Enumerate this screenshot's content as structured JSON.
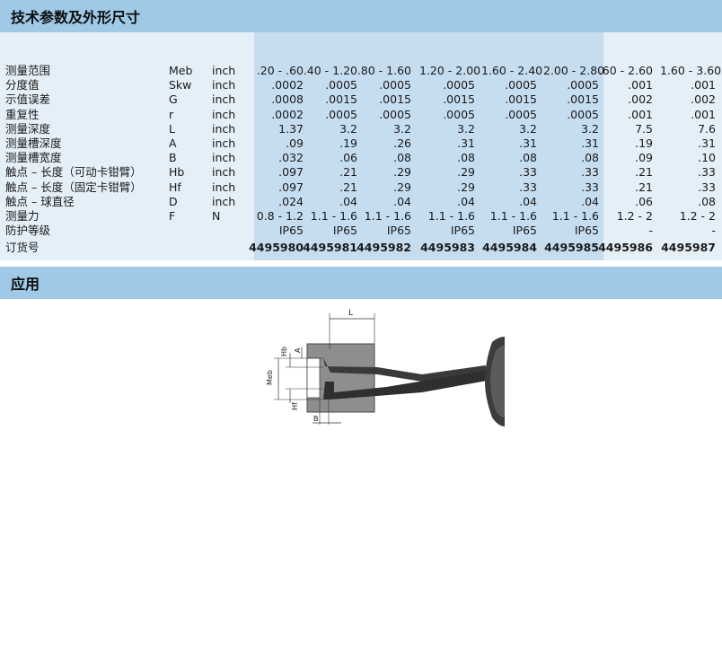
{
  "sections": {
    "specs_title": "技术参数及外形尺寸",
    "application_title": "应用"
  },
  "table": {
    "rows": [
      {
        "label": "测量范围",
        "symbol": "Meb",
        "unit": "inch",
        "values": [
          ".20 - .60",
          ".40 - 1.20",
          ".80 - 1.60",
          "1.20 - 2.00",
          "1.60 - 2.40",
          "2.00 - 2.80",
          ".60 - 2.60",
          "1.60 - 3.60"
        ]
      },
      {
        "label": "分度值",
        "symbol": "Skw",
        "unit": "inch",
        "values": [
          ".0002",
          ".0005",
          ".0005",
          ".0005",
          ".0005",
          ".0005",
          ".001",
          ".001"
        ]
      },
      {
        "label": "示值误差",
        "symbol": "G",
        "unit": "inch",
        "values": [
          ".0008",
          ".0015",
          ".0015",
          ".0015",
          ".0015",
          ".0015",
          ".002",
          ".002"
        ]
      },
      {
        "label": "重复性",
        "symbol": "r",
        "unit": "inch",
        "values": [
          ".0002",
          ".0005",
          ".0005",
          ".0005",
          ".0005",
          ".0005",
          ".001",
          ".001"
        ]
      },
      {
        "label": "测量深度",
        "symbol": "L",
        "unit": "inch",
        "values": [
          "1.37",
          "3.2",
          "3.2",
          "3.2",
          "3.2",
          "3.2",
          "7.5",
          "7.6"
        ]
      },
      {
        "label": "测量槽深度",
        "symbol": "A",
        "unit": "inch",
        "values": [
          ".09",
          ".19",
          ".26",
          ".31",
          ".31",
          ".31",
          ".19",
          ".31"
        ]
      },
      {
        "label": "测量槽宽度",
        "symbol": "B",
        "unit": "inch",
        "values": [
          ".032",
          ".06",
          ".08",
          ".08",
          ".08",
          ".08",
          ".09",
          ".10"
        ]
      },
      {
        "label": "触点 – 长度（可动卡钳臂）",
        "symbol": "Hb",
        "unit": "inch",
        "values": [
          ".097",
          ".21",
          ".29",
          ".29",
          ".33",
          ".33",
          ".21",
          ".33"
        ]
      },
      {
        "label": "触点 – 长度（固定卡钳臂）",
        "symbol": "Hf",
        "unit": "inch",
        "values": [
          ".097",
          ".21",
          ".29",
          ".29",
          ".33",
          ".33",
          ".21",
          ".33"
        ]
      },
      {
        "label": "触点 – 球直径",
        "symbol": "D",
        "unit": "inch",
        "values": [
          ".024",
          ".04",
          ".04",
          ".04",
          ".04",
          ".04",
          ".06",
          ".08"
        ]
      },
      {
        "label": "测量力",
        "symbol": "F",
        "unit": "N",
        "values": [
          "0.8 - 1.2",
          "1.1 - 1.6",
          "1.1 - 1.6",
          "1.1 - 1.6",
          "1.1 - 1.6",
          "1.1 - 1.6",
          "1.2 - 2",
          "1.2 - 2"
        ]
      },
      {
        "label": "防护等级",
        "symbol": "",
        "unit": "",
        "values": [
          "IP65",
          "IP65",
          "IP65",
          "IP65",
          "IP65",
          "IP65",
          "-",
          "-"
        ]
      }
    ],
    "order": {
      "label": "订货号",
      "values": [
        "4495980",
        "4495981",
        "4495982",
        "4495983",
        "4495984",
        "4495985",
        "4495986",
        "4495987"
      ]
    }
  },
  "diagram": {
    "labels": {
      "L": "L",
      "Hb": "Hb",
      "A": "A",
      "Meb": "Meb",
      "Hf": "Hf",
      "B": "B"
    }
  }
}
